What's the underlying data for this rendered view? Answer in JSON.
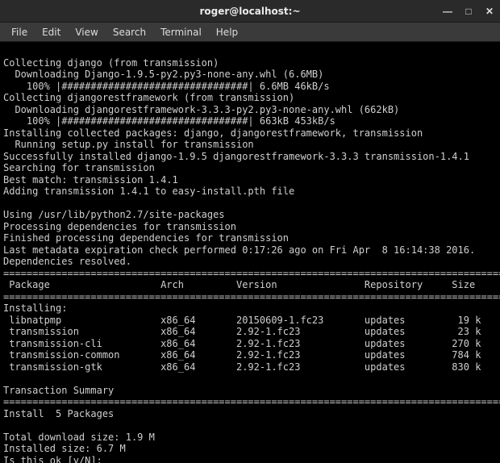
{
  "title": "roger@localhost:~",
  "menu": {
    "file": "File",
    "edit": "Edit",
    "view": "View",
    "search": "Search",
    "terminal": "Terminal",
    "help": "Help"
  },
  "controls": {
    "minimize": "—",
    "maximize": "□",
    "close": "✕"
  },
  "lines": {
    "l1": "Collecting django (from transmission)",
    "l2": "  Downloading Django-1.9.5-py2.py3-none-any.whl (6.6MB)",
    "l3": "    100% |################################| 6.6MB 46kB/s",
    "l4": "Collecting djangorestframework (from transmission)",
    "l5": "  Downloading djangorestframework-3.3.3-py2.py3-none-any.whl (662kB)",
    "l6": "    100% |################################| 663kB 453kB/s",
    "l7": "Installing collected packages: django, djangorestframework, transmission",
    "l8": "  Running setup.py install for transmission",
    "l9": "Successfully installed django-1.9.5 djangorestframework-3.3.3 transmission-1.4.1",
    "l10": "Searching for transmission",
    "l11": "Best match: transmission 1.4.1",
    "l12": "Adding transmission 1.4.1 to easy-install.pth file",
    "l13": "",
    "l14": "Using /usr/lib/python2.7/site-packages",
    "l15": "Processing dependencies for transmission",
    "l16": "Finished processing dependencies for transmission",
    "l17": "Last metadata expiration check performed 0:17:26 ago on Fri Apr  8 16:14:38 2016.",
    "l18": "Dependencies resolved.",
    "l19": "================================================================================================",
    "l20": " Package                   Arch         Version               Repository     Size",
    "l21": "================================================================================================",
    "l22": "Installing:",
    "l23": " libnatpmp                 x86_64       20150609-1.fc23       updates         19 k",
    "l24": " transmission              x86_64       2.92-1.fc23           updates         23 k",
    "l25": " transmission-cli          x86_64       2.92-1.fc23           updates        270 k",
    "l26": " transmission-common       x86_64       2.92-1.fc23           updates        784 k",
    "l27": " transmission-gtk          x86_64       2.92-1.fc23           updates        830 k",
    "l28": "",
    "l29": "Transaction Summary",
    "l30": "================================================================================================",
    "l31": "Install  5 Packages",
    "l32": "",
    "l33": "Total download size: 1.9 M",
    "l34": "Installed size: 6.7 M",
    "l35": "Is this ok [y/N]: "
  }
}
